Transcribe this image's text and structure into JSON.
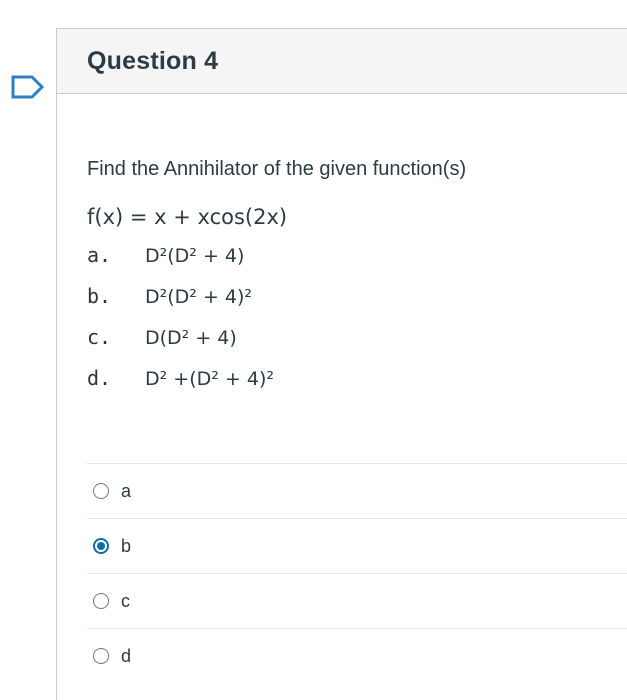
{
  "question": {
    "title": "Question 4",
    "prompt": "Find the Annihilator of the given function(s)",
    "function": "f(x) = x + xcos(2x)",
    "options": [
      {
        "letter": "a.",
        "expr": "D²(D² + 4)"
      },
      {
        "letter": "b.",
        "expr": "D²(D² + 4)²"
      },
      {
        "letter": "c.",
        "expr": "D(D² + 4)"
      },
      {
        "letter": "d.",
        "expr": "D² +(D² + 4)²"
      }
    ]
  },
  "answers": [
    {
      "label": "a",
      "selected": false
    },
    {
      "label": "b",
      "selected": true
    },
    {
      "label": "c",
      "selected": false
    },
    {
      "label": "d",
      "selected": false
    }
  ],
  "colors": {
    "accent": "#0770a3",
    "flag": "#2d7fc4",
    "text": "#2d3b45"
  },
  "icons": {
    "flag": "flag-bookmark-icon"
  }
}
